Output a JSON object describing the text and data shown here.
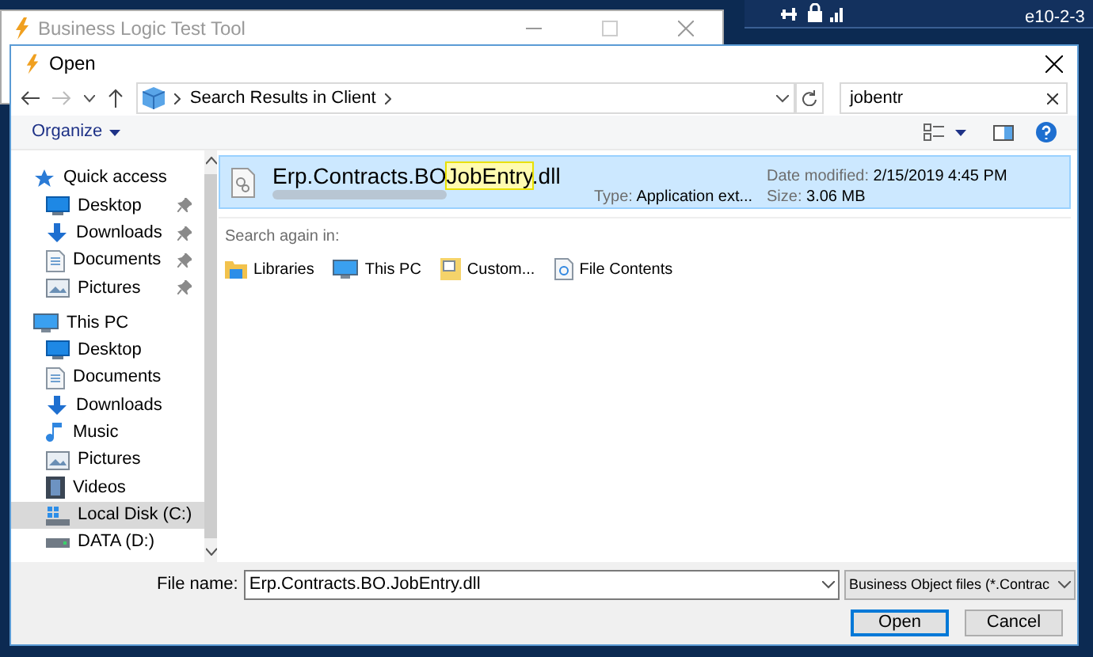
{
  "back_window": {
    "title": "Business Logic Test Tool"
  },
  "remote_bar": {
    "label": "e10-2-3"
  },
  "dialog": {
    "title": "Open",
    "address": {
      "crumbs": [
        "Search Results in Client"
      ]
    },
    "search": {
      "value": "jobentr"
    },
    "toolbar": {
      "organize": "Organize"
    },
    "sidebar": [
      {
        "label": "Quick access",
        "kind": "group",
        "selected": false,
        "children": [
          {
            "label": "Desktop",
            "pinned": true,
            "selected": false
          },
          {
            "label": "Downloads",
            "pinned": true,
            "selected": false
          },
          {
            "label": "Documents",
            "pinned": true,
            "selected": false
          },
          {
            "label": "Pictures",
            "pinned": true,
            "selected": false
          }
        ]
      },
      {
        "label": "This PC",
        "kind": "group",
        "selected": false,
        "children": [
          {
            "label": "Desktop",
            "pinned": false,
            "selected": false
          },
          {
            "label": "Documents",
            "pinned": false,
            "selected": false
          },
          {
            "label": "Downloads",
            "pinned": false,
            "selected": false
          },
          {
            "label": "Music",
            "pinned": false,
            "selected": false
          },
          {
            "label": "Pictures",
            "pinned": false,
            "selected": false
          },
          {
            "label": "Videos",
            "pinned": false,
            "selected": false
          },
          {
            "label": "Local Disk (C:)",
            "pinned": false,
            "selected": true
          },
          {
            "label": "DATA (D:)",
            "pinned": false,
            "selected": false
          }
        ]
      }
    ],
    "results": [
      {
        "name_parts": [
          {
            "text": "Erp.Contracts.BO",
            "match": false
          },
          {
            "text": "JobEntry",
            "match": true
          },
          {
            "text": ".dll",
            "match": false
          }
        ],
        "type_label": "Type:",
        "type": "Application ext...",
        "date_label": "Date modified:",
        "date": "2/15/2019 4:45 PM",
        "size_label": "Size:",
        "size": "3.06 MB",
        "selected": true
      }
    ],
    "search_again": {
      "label": "Search again in:",
      "targets": [
        {
          "label": "Libraries"
        },
        {
          "label": "This PC"
        },
        {
          "label": "Custom..."
        },
        {
          "label": "File Contents"
        }
      ]
    },
    "file_name": {
      "label": "File name:",
      "value": "Erp.Contracts.BO.JobEntry.dll"
    },
    "file_type": {
      "value": "Business Object files (*.Contrac"
    },
    "buttons": [
      {
        "label": "Open",
        "default": true
      },
      {
        "label": "Cancel",
        "default": false
      }
    ]
  }
}
